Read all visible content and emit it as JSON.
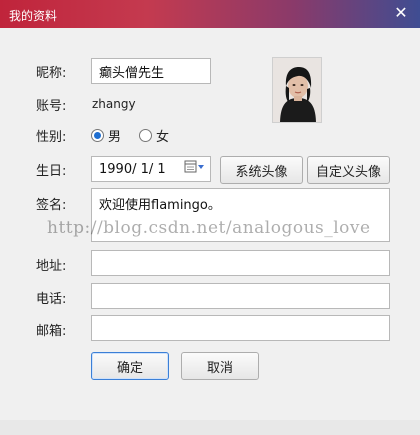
{
  "window": {
    "title": "我的资料",
    "close_glyph": "✕"
  },
  "labels": {
    "nickname": "昵称:",
    "account": "账号:",
    "gender": "性别:",
    "birthday": "生日:",
    "signature": "签名:",
    "address": "地址:",
    "phone": "电话:",
    "email": "邮箱:"
  },
  "fields": {
    "nickname": "癫头僧先生",
    "account": "zhangy",
    "birthday": "1990/  1/  1",
    "signature": "欢迎使用flamingo。",
    "address": "",
    "phone": "",
    "email": ""
  },
  "gender": {
    "male_label": "男",
    "female_label": "女",
    "selected": "male"
  },
  "buttons": {
    "system_avatar": "系统头像",
    "custom_avatar": "自定义头像",
    "ok": "确定",
    "cancel": "取消"
  },
  "watermark": "http://blog.csdn.net/analogous_love",
  "icons": {
    "close": "close-icon",
    "calendar": "calendar-icon",
    "avatar": "avatar-image"
  }
}
